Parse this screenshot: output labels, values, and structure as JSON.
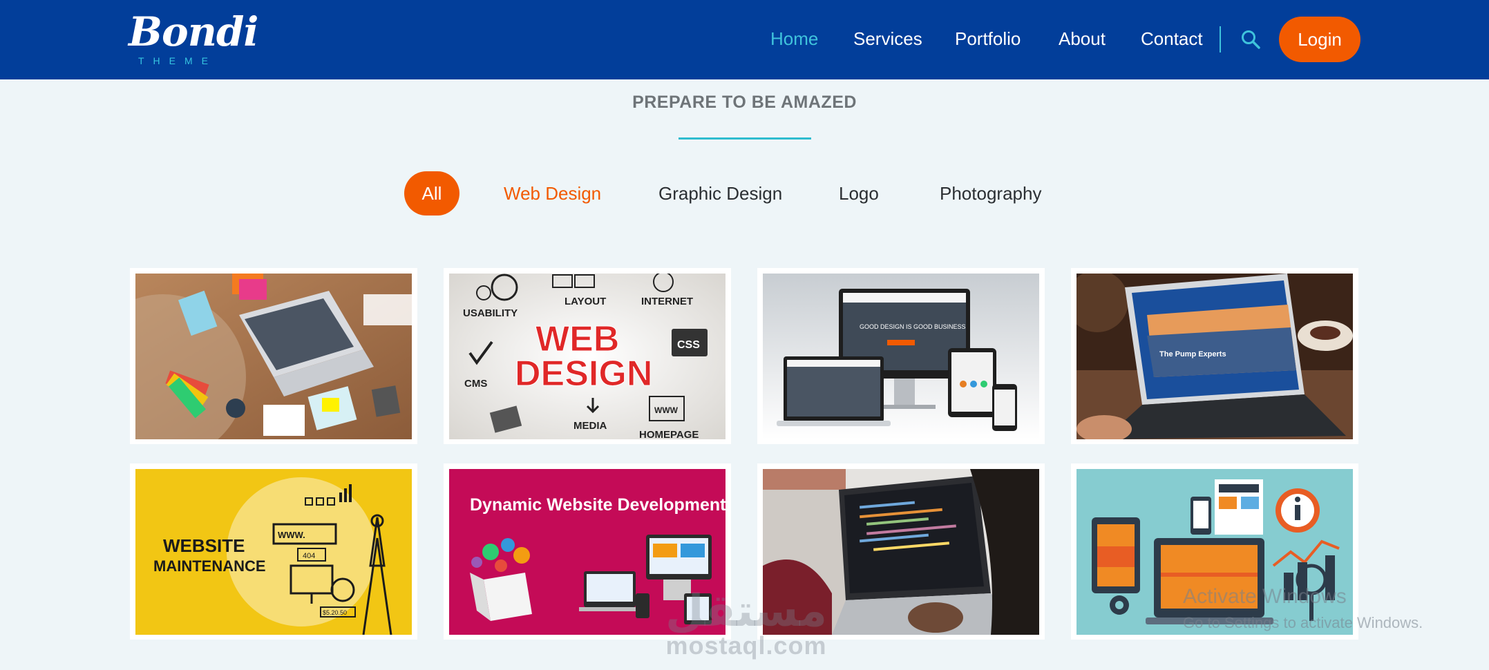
{
  "header": {
    "logo": {
      "script": "Bondi",
      "sub": "THEME"
    },
    "nav": [
      {
        "label": "Home",
        "active": true
      },
      {
        "label": "Services",
        "active": false
      },
      {
        "label": "Portfolio",
        "active": false
      },
      {
        "label": "About",
        "active": false
      },
      {
        "label": "Contact",
        "active": false
      }
    ],
    "search_icon": "search-icon",
    "login_label": "Login"
  },
  "section": {
    "title": "PREPARE TO BE AMAZED"
  },
  "filters": [
    {
      "label": "All",
      "state": "selected"
    },
    {
      "label": "Web Design",
      "state": "hover"
    },
    {
      "label": "Graphic Design",
      "state": "normal"
    },
    {
      "label": "Logo",
      "state": "normal"
    },
    {
      "label": "Photography",
      "state": "normal"
    }
  ],
  "portfolio": {
    "items": [
      {
        "image": "desk-laptop-photo"
      },
      {
        "image": "web-design-concept-illustration",
        "texts": [
          "USABILITY",
          "LAYOUT",
          "INTERNET",
          "WEB",
          "DESIGN",
          "CSS",
          "CMS",
          "MEDIA",
          "WWW",
          "HOMEPAGE"
        ]
      },
      {
        "image": "responsive-devices-mockup",
        "texts": [
          "GOOD DESIGN IS GOOD BUSINESS"
        ]
      },
      {
        "image": "laptop-website-photo",
        "texts": [
          "The Pump Experts"
        ]
      },
      {
        "image": "website-maintenance-illustration",
        "texts": [
          "WEBSITE",
          "MAINTENANCE",
          "WWW.",
          "404",
          "$5.20.50"
        ]
      },
      {
        "image": "dynamic-website-development-banner",
        "texts": [
          "Dynamic Website Development"
        ]
      },
      {
        "image": "coding-laptop-photo"
      },
      {
        "image": "flat-devices-illustration"
      }
    ]
  },
  "overlays": {
    "activate_title": "Activate Windows",
    "activate_sub": "Go to Settings to activate Windows.",
    "watermark_ar": "مستقل",
    "watermark_en": "mostaql.com"
  },
  "colors": {
    "navbar": "#023e9a",
    "accent_orange": "#f25a00",
    "accent_cyan": "#3fc3dc",
    "background": "#eef5f8"
  }
}
